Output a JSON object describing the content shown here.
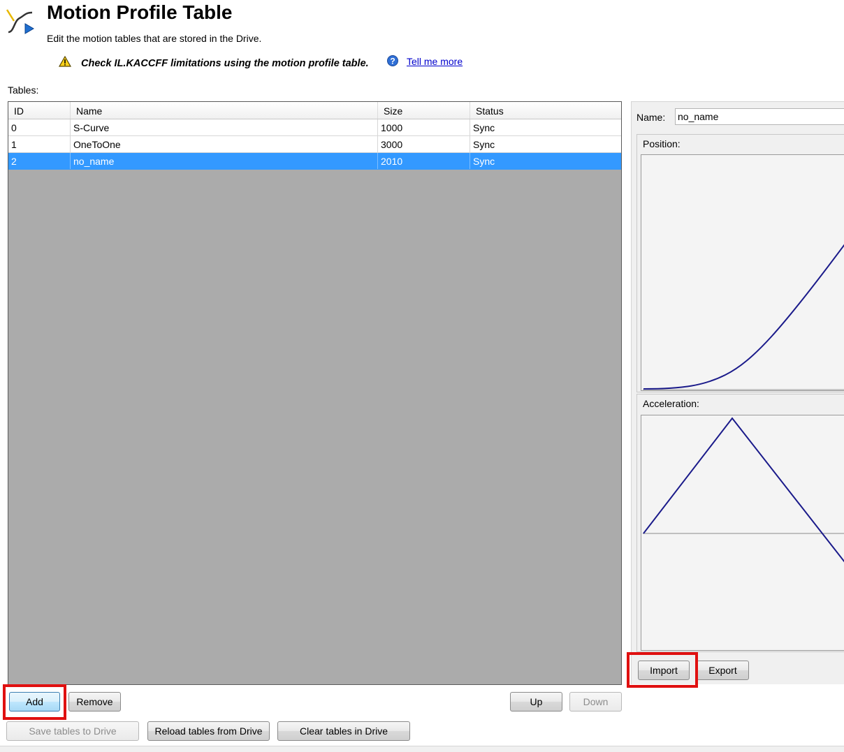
{
  "header": {
    "title": "Motion Profile Table",
    "subtitle": "Edit the motion tables that are stored in the Drive.",
    "warning_text": "Check IL.KACCFF limitations using the motion profile table.",
    "help_link": "Tell me more"
  },
  "tables": {
    "label": "Tables:",
    "columns": [
      "ID",
      "Name",
      "Size",
      "Status"
    ],
    "rows": [
      {
        "id": "0",
        "name": "S-Curve",
        "size": "1000",
        "status": "Sync"
      },
      {
        "id": "1",
        "name": "OneToOne",
        "size": "3000",
        "status": "Sync"
      },
      {
        "id": "2",
        "name": "no_name",
        "size": "2010",
        "status": "Sync",
        "selected": true
      }
    ]
  },
  "buttons": {
    "add": "Add",
    "remove": "Remove",
    "up": "Up",
    "down": "Down",
    "save": "Save tables to Drive",
    "reload": "Reload tables from Drive",
    "clear": "Clear tables in Drive",
    "import": "Import",
    "export": "Export"
  },
  "detail": {
    "name_label": "Name:",
    "name_value": "no_name",
    "position_label": "Position:",
    "acceleration_label": "Acceleration:"
  },
  "colors": {
    "selection": "#3399ff",
    "curve": "#1a1a8a",
    "highlight_box": "#e01010",
    "grid_background": "#ababab"
  },
  "icons": {
    "app": "motion-profile-icon",
    "warning": "warning-icon",
    "help": "help-icon"
  }
}
